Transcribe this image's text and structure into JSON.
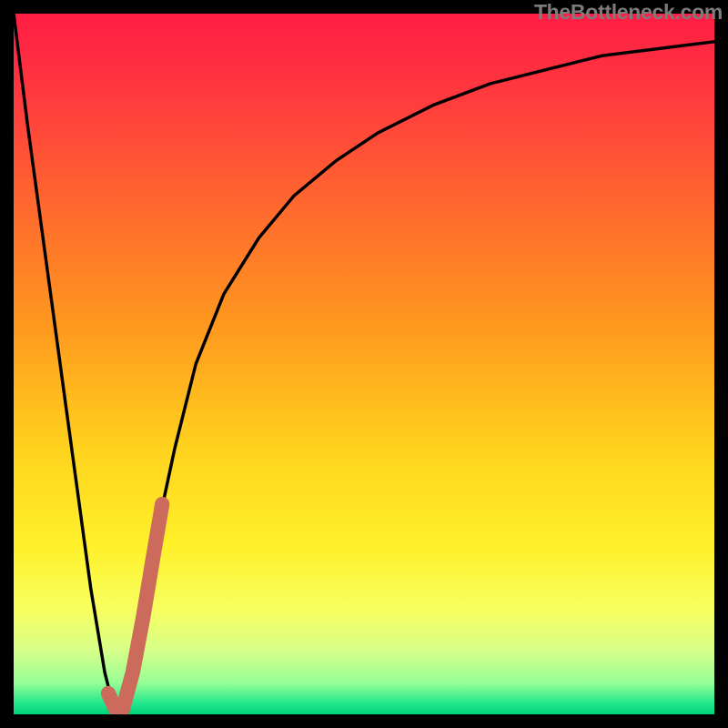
{
  "watermark": {
    "text": "TheBottleneck.com"
  },
  "colors": {
    "background": "#000000",
    "stroke_main": "#000000",
    "stroke_accent": "#cc6a5c",
    "gradient_stops": [
      {
        "offset": 0.0,
        "color": "#ff1d44"
      },
      {
        "offset": 0.12,
        "color": "#ff3a3e"
      },
      {
        "offset": 0.28,
        "color": "#ff6a2e"
      },
      {
        "offset": 0.45,
        "color": "#ff9a1e"
      },
      {
        "offset": 0.62,
        "color": "#ffd21e"
      },
      {
        "offset": 0.76,
        "color": "#fff12a"
      },
      {
        "offset": 0.85,
        "color": "#f8ff60"
      },
      {
        "offset": 0.91,
        "color": "#d6ff8a"
      },
      {
        "offset": 0.955,
        "color": "#96ff96"
      },
      {
        "offset": 0.985,
        "color": "#20e68c"
      },
      {
        "offset": 1.0,
        "color": "#00d27a"
      }
    ]
  },
  "chart_data": {
    "type": "line",
    "title": "",
    "xlabel": "",
    "ylabel": "",
    "xlim": [
      0,
      100
    ],
    "ylim": [
      0,
      100
    ],
    "series": [
      {
        "name": "bottleneck-curve",
        "x": [
          0,
          2,
          5,
          8,
          11,
          13,
          14,
          15,
          16,
          18,
          20,
          23,
          26,
          30,
          35,
          40,
          46,
          52,
          60,
          68,
          76,
          84,
          92,
          100
        ],
        "y": [
          100,
          84,
          62,
          40,
          18,
          6,
          2,
          0,
          3,
          12,
          24,
          38,
          50,
          60,
          68,
          74,
          79,
          83,
          87,
          90,
          92,
          94,
          95,
          96
        ]
      },
      {
        "name": "highlight-segment",
        "x": [
          13.5,
          14.5,
          15.5,
          17.0,
          18.5,
          20.0,
          21.2
        ],
        "y": [
          3.0,
          0.8,
          0.5,
          6.0,
          14.0,
          23.0,
          30.0
        ]
      }
    ]
  }
}
